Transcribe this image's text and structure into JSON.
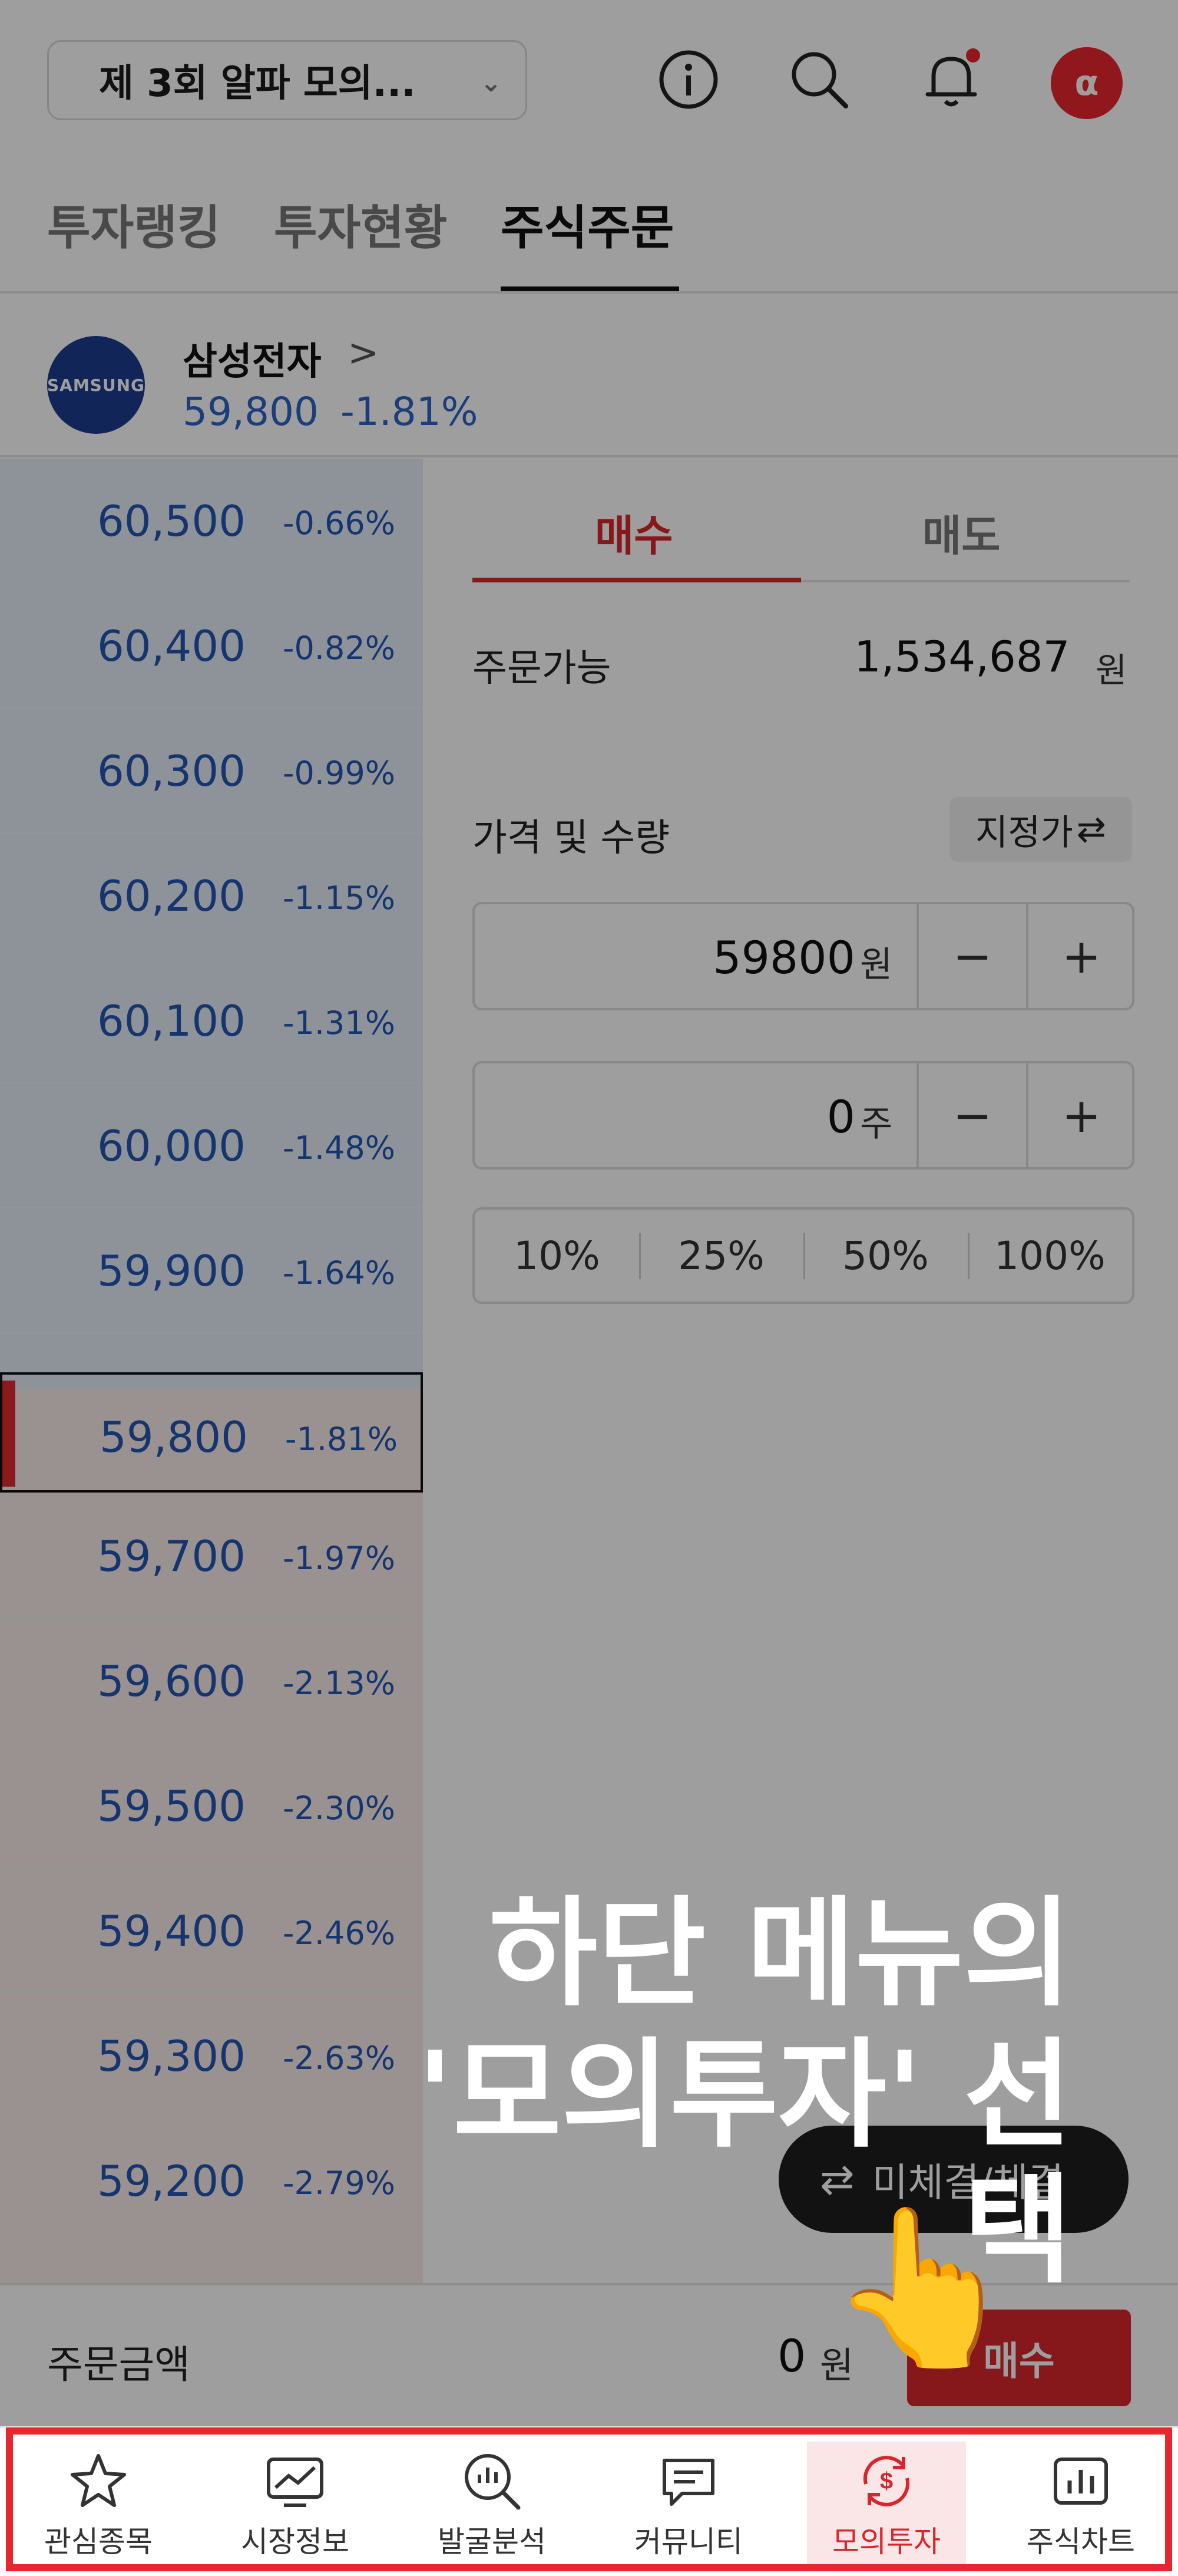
{
  "header": {
    "contest_select": "제 3회 알파 모의...",
    "icons": [
      "info-icon",
      "search-icon",
      "bell-icon",
      "profile-avatar"
    ],
    "avatar_glyph": "α"
  },
  "tabs": [
    {
      "label": "투자랭킹",
      "active": false
    },
    {
      "label": "투자현황",
      "active": false
    },
    {
      "label": "주식주문",
      "active": true
    }
  ],
  "stock": {
    "logo_text": "SAMSUNG",
    "name": "삼성전자",
    "name_chevron": ">",
    "price": "59,800",
    "change": "-1.81%"
  },
  "order_book": [
    {
      "price": "60,500",
      "rate": "-0.66%"
    },
    {
      "price": "60,400",
      "rate": "-0.82%"
    },
    {
      "price": "60,300",
      "rate": "-0.99%"
    },
    {
      "price": "60,200",
      "rate": "-1.15%"
    },
    {
      "price": "60,100",
      "rate": "-1.31%"
    },
    {
      "price": "60,000",
      "rate": "-1.48%"
    },
    {
      "price": "59,900",
      "rate": "-1.64%"
    },
    {
      "price": "59,800",
      "rate": "-1.81%",
      "current": true
    },
    {
      "price": "59,700",
      "rate": "-1.97%"
    },
    {
      "price": "59,600",
      "rate": "-2.13%"
    },
    {
      "price": "59,500",
      "rate": "-2.30%"
    },
    {
      "price": "59,400",
      "rate": "-2.46%"
    },
    {
      "price": "59,300",
      "rate": "-2.63%"
    },
    {
      "price": "59,200",
      "rate": "-2.79%"
    }
  ],
  "order_panel": {
    "buy_tab": "매수",
    "sell_tab": "매도",
    "available_label": "주문가능",
    "available_value": "1,534,687",
    "available_unit": "원",
    "price_qty_label": "가격 및 수량",
    "order_type": "지정가",
    "price_value": "59800",
    "price_unit": "원",
    "qty_value": "0",
    "qty_unit": "주",
    "minus": "−",
    "plus": "+",
    "percents": [
      "10%",
      "25%",
      "50%",
      "100%"
    ]
  },
  "floating": {
    "unfilled_label": "미체결/체결"
  },
  "order_bar": {
    "amount_label": "주문금액",
    "amount_value": "0",
    "amount_unit": "원",
    "buy_button": "매수"
  },
  "bottom_nav": [
    {
      "label": "관심종목",
      "icon": "star-icon"
    },
    {
      "label": "시장정보",
      "icon": "market-chart-icon"
    },
    {
      "label": "발굴분석",
      "icon": "analysis-search-icon"
    },
    {
      "label": "커뮤니티",
      "icon": "chat-icon"
    },
    {
      "label": "모의투자",
      "icon": "mock-invest-icon",
      "active": true
    },
    {
      "label": "주식차트",
      "icon": "bar-chart-icon"
    }
  ],
  "overlay": {
    "line1": "하단 메뉴의",
    "line2": "'모의투자' 선택",
    "pointer": "👆"
  },
  "colors": {
    "accent_red": "#d9262d",
    "price_blue": "#2456b4",
    "overlay_frame": "#e8262e"
  }
}
